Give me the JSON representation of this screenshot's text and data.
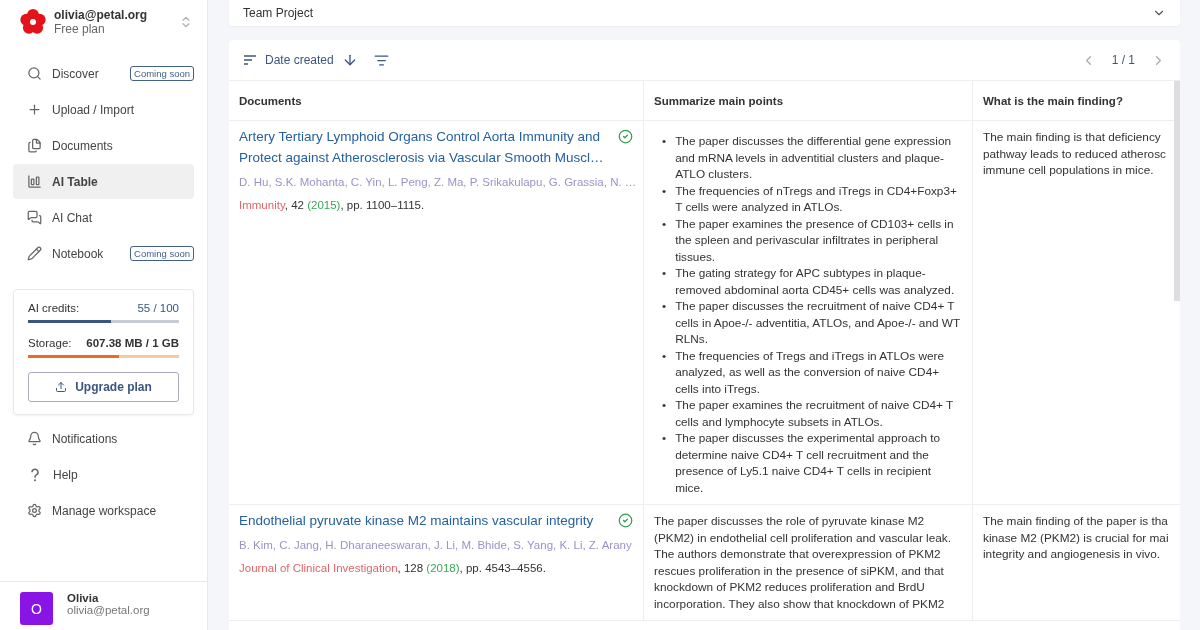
{
  "account": {
    "email": "olivia@petal.org",
    "plan": "Free plan"
  },
  "nav": [
    {
      "label": "Discover",
      "badge": "Coming soon",
      "selected": false
    },
    {
      "label": "Upload / Import",
      "selected": false
    },
    {
      "label": "Documents",
      "selected": false
    },
    {
      "label": "AI Table",
      "selected": true
    },
    {
      "label": "AI Chat",
      "selected": false
    },
    {
      "label": "Notebook",
      "badge": "Coming soon",
      "selected": false
    }
  ],
  "usage": {
    "credits": {
      "label": "AI credits:",
      "value": "55 / 100",
      "level": 0.55
    },
    "storage": {
      "label": "Storage:",
      "value": "607.38 MB / 1 GB",
      "level": 0.6
    },
    "upgrade": "Upgrade plan"
  },
  "footer_nav": [
    {
      "label": "Notifications"
    },
    {
      "label": "Help"
    },
    {
      "label": "Manage workspace"
    }
  ],
  "user": {
    "initial": "O",
    "name": "Olivia",
    "email": "olivia@petal.org"
  },
  "project": {
    "name": "Team Project"
  },
  "toolbar": {
    "sort": "Date created",
    "page": "1 / 1"
  },
  "table": {
    "columns": [
      "Documents",
      "Summarize main points",
      "What is the main finding?"
    ],
    "rows": [
      {
        "title": "Artery Tertiary Lymphoid Organs Control Aorta Immunity and Protect against Atherosclerosis via Vascular Smooth Muscl…",
        "done": true,
        "authors": "D. Hu, S.K. Mohanta, C. Yin, L. Peng, Z. Ma, P. Srikakulapu, G. Grassia, N. …",
        "citation": [
          {
            "kind": "journal",
            "text": "Immunity"
          },
          {
            "kind": "plain",
            "text": ", 42 "
          },
          {
            "kind": "year",
            "text": "(2015)"
          },
          {
            "kind": "plain",
            "text": ", pp. 1100–1115."
          }
        ],
        "summary": {
          "kind": "bullets",
          "marker": "•",
          "items": [
            "The paper discusses the differential gene expression and mRNA levels in adventitial clusters and plaque-ATLO clusters.",
            "The frequencies of nTregs and iTregs in CD4+Foxp3+ T cells were analyzed in ATLOs.",
            "The paper examines the presence of CD103+ cells in the spleen and perivascular infiltrates in peripheral tissues.",
            "The gating strategy for APC subtypes in plaque-removed abdominal aorta CD45+ cells was analyzed.",
            "The paper discusses the recruitment of naive CD4+ T cells in Apoe-/- adventitia, ATLOs, and Apoe-/- and WT RLNs.",
            "The frequencies of Tregs and iTregs in ATLOs were analyzed, as well as the conversion of naive CD4+ cells into iTregs.",
            "The paper examines the recruitment of naive CD4+ T cells and lymphocyte subsets in ATLOs.",
            "The paper discusses the experimental approach to determine naive CD4+ T cell recruitment and the presence of Ly5.1 naive CD4+ T cells in recipient mice."
          ]
        },
        "finding": [
          "The main finding is that deficiency",
          "pathway leads to reduced atherosc",
          "immune cell populations in mice."
        ]
      },
      {
        "title": "Endothelial pyruvate kinase M2 maintains vascular integrity",
        "done": true,
        "authors": "B. Kim, C. Jang, H. Dharaneeswaran, J. Li, M. Bhide, S. Yang, K. Li, Z. Arany",
        "citation": [
          {
            "kind": "journal",
            "text": "Journal of Clinical Investigation"
          },
          {
            "kind": "plain",
            "text": ", 128 "
          },
          {
            "kind": "year",
            "text": "(2018)"
          },
          {
            "kind": "plain",
            "text": ", pp. 4543–4556."
          }
        ],
        "summary": {
          "kind": "text",
          "text": "The paper discusses the role of pyruvate kinase M2 (PKM2) in endothelial cell proliferation and vascular leak. The authors demonstrate that overexpression of PKM2 rescues proliferation in the presence of siPKM, and that knockdown of PKM2 reduces proliferation and BrdU incorporation. They also show that knockdown of PKM2"
        },
        "finding": [
          "The main finding of the paper is tha",
          "kinase M2 (PKM2) is crucial for mai",
          "integrity and angiogenesis in vivo."
        ]
      }
    ]
  }
}
